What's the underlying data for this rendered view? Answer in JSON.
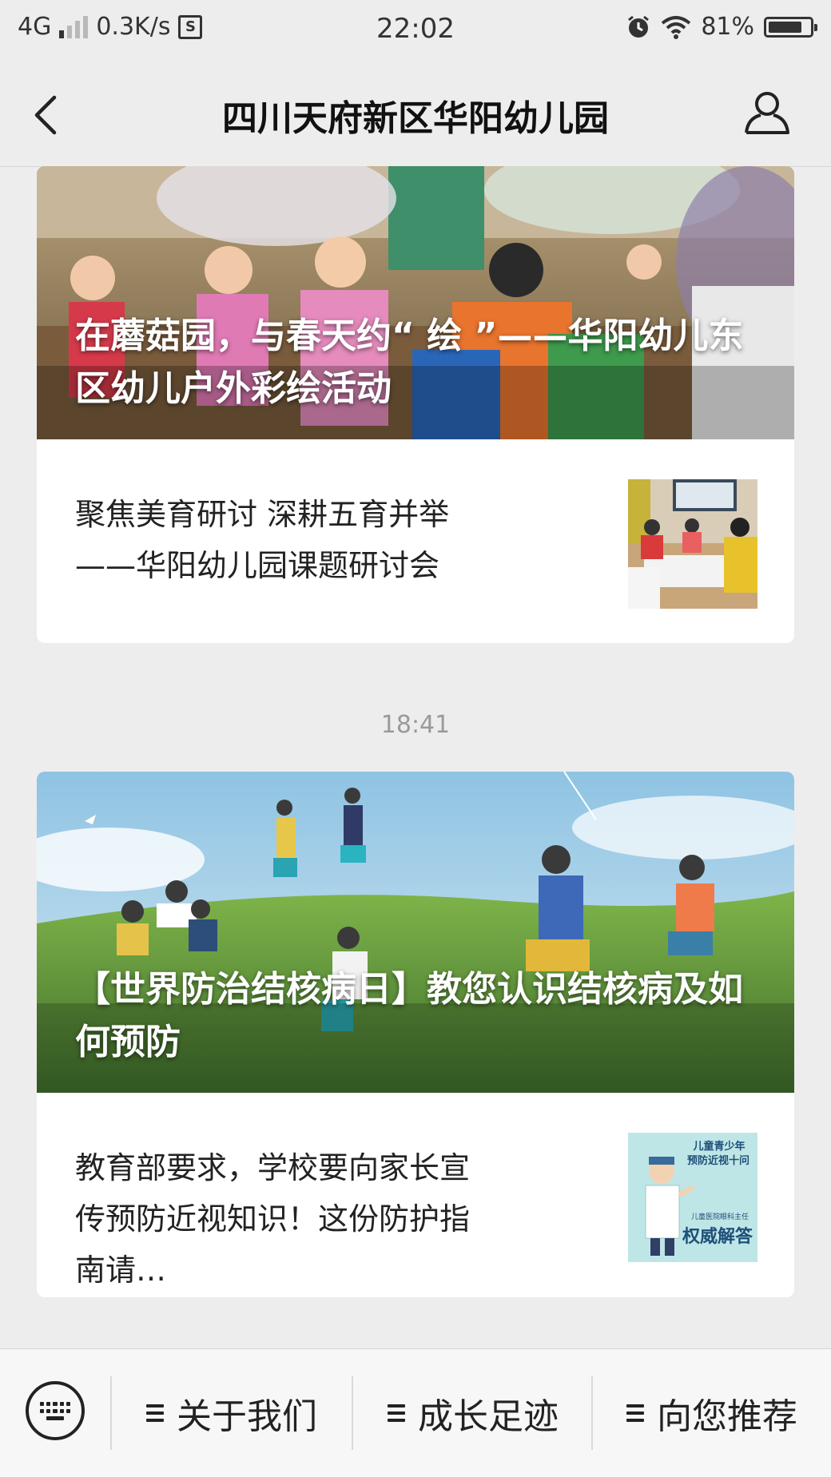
{
  "status_bar": {
    "network": "4G",
    "speed": "0.3K/s",
    "time": "22:02",
    "battery_percent": "81%",
    "battery_level": 0.81
  },
  "nav": {
    "title": "四川天府新区华阳幼儿园"
  },
  "card1": {
    "hero_title": "在蘑菇园，与春天约“ 绘 ”——华阳幼儿东区幼儿户外彩绘活动",
    "sub_title": "聚焦美育研讨  深耕五育并举——华阳幼儿园课题研讨会"
  },
  "timestamp": "18:41",
  "card2": {
    "hero_title": "【世界防治结核病日】教您认识结核病及如何预防",
    "sub_title": "教育部要求，学校要向家长宣传预防近视知识！这份防护指南请…",
    "thumb_text_line1": "儿童青少年",
    "thumb_text_line2": "预防近视十问",
    "thumb_text_small": "儿童医院眼科主任",
    "thumb_text_big": "权威解答"
  },
  "menu": {
    "items": [
      {
        "label": "关于我们"
      },
      {
        "label": "成长足迹"
      },
      {
        "label": "向您推荐"
      }
    ]
  },
  "colors": {
    "background": "#ededed",
    "card": "#ffffff",
    "timestamp": "#9a9a9a"
  }
}
